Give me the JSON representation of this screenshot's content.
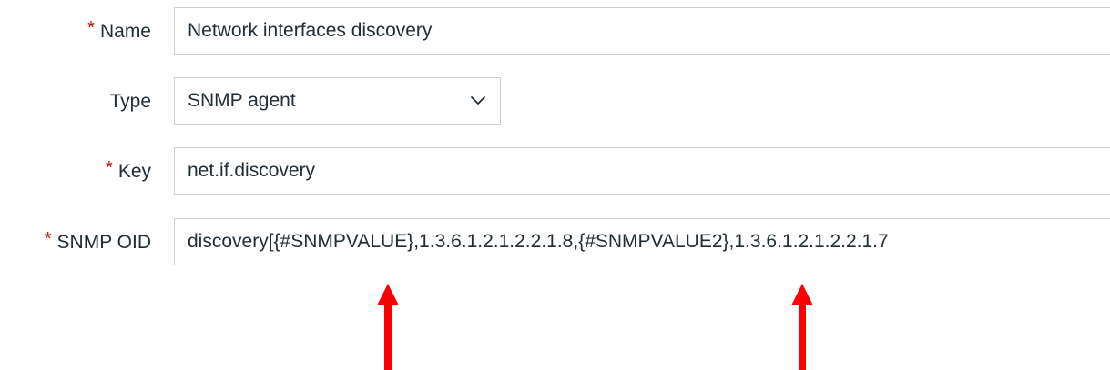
{
  "form": {
    "required_mark": "*",
    "name": {
      "label": "Name",
      "value": "Network interfaces discovery"
    },
    "type": {
      "label": "Type",
      "selected": "SNMP agent"
    },
    "key": {
      "label": "Key",
      "value": "net.if.discovery"
    },
    "snmp_oid": {
      "label": "SNMP OID",
      "value": "discovery[{#SNMPVALUE},1.3.6.1.2.1.2.2.1.8,{#SNMPVALUE2},1.3.6.1.2.1.2.2.1.7"
    }
  },
  "colors": {
    "required": "#d40000",
    "annotation_arrow": "#ff0000",
    "field_border": "#c9d1d6",
    "text": "#1f2c33"
  },
  "icons": {
    "dropdown": "chevron-down-icon",
    "annotation": "arrow-up-icon"
  }
}
